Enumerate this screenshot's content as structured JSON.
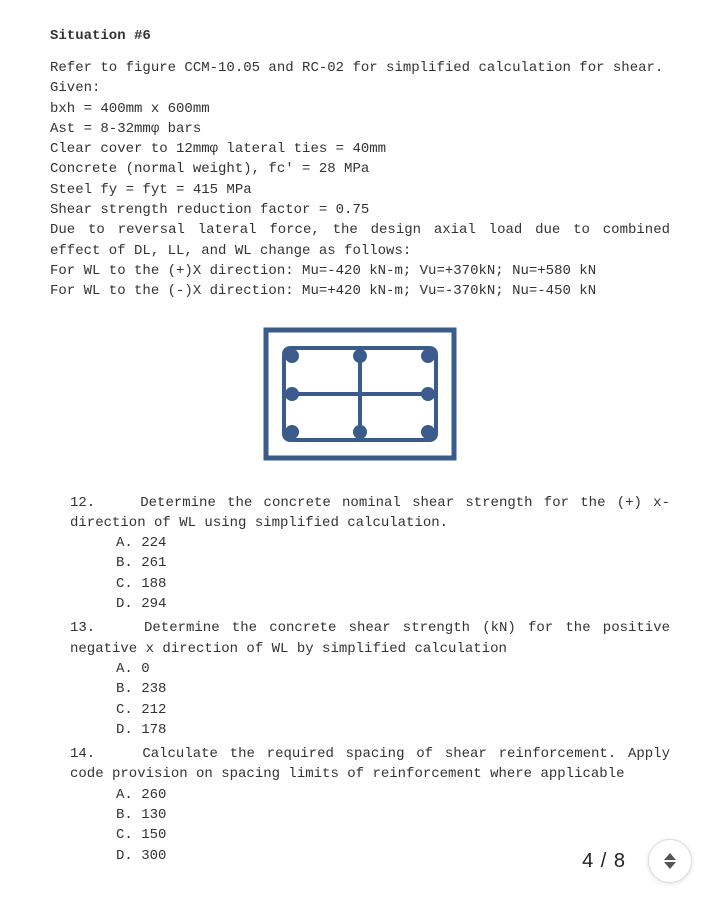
{
  "title": "Situation #6",
  "intro_lines": [
    "Refer to figure CCM-10.05 and RC-02 for simplified calculation for shear.",
    "Given:",
    "bxh = 400mm x 600mm",
    "Ast = 8-32mmφ bars",
    "Clear cover to 12mmφ lateral ties = 40mm",
    "Concrete (normal weight), fc' = 28 MPa",
    "Steel fy = fyt = 415 MPa",
    "Shear strength reduction factor = 0.75",
    "Due to reversal lateral force, the design axial load due to combined effect of DL, LL, and WL change as follows:",
    "For WL to the (+)X direction: Mu=-420 kN-m; Vu=+370kN; Nu=+580 kN",
    "For WL to the (-)X direction: Mu=+420 kN-m; Vu=-370kN; Nu=-450 kN"
  ],
  "questions": [
    {
      "num": "12.",
      "text": "Determine the concrete nominal shear strength for the (+) x- direction of WL using simplified calculation.",
      "opts": [
        "A. 224",
        "B. 261",
        "C. 188",
        "D. 294"
      ]
    },
    {
      "num": "13.",
      "text": "Determine the concrete shear strength (kN) for the positive negative x direction of WL by simplified calculation",
      "opts": [
        "A. 0",
        "B. 238",
        "C. 212",
        "D. 178"
      ]
    },
    {
      "num": "14.",
      "text": "Calculate the required spacing of shear reinforcement. Apply code provision on spacing limits of reinforcement where applicable",
      "opts": [
        "A. 260",
        "B. 130",
        "C. 150",
        "D. 300"
      ]
    }
  ],
  "page_counter": "4 / 8"
}
